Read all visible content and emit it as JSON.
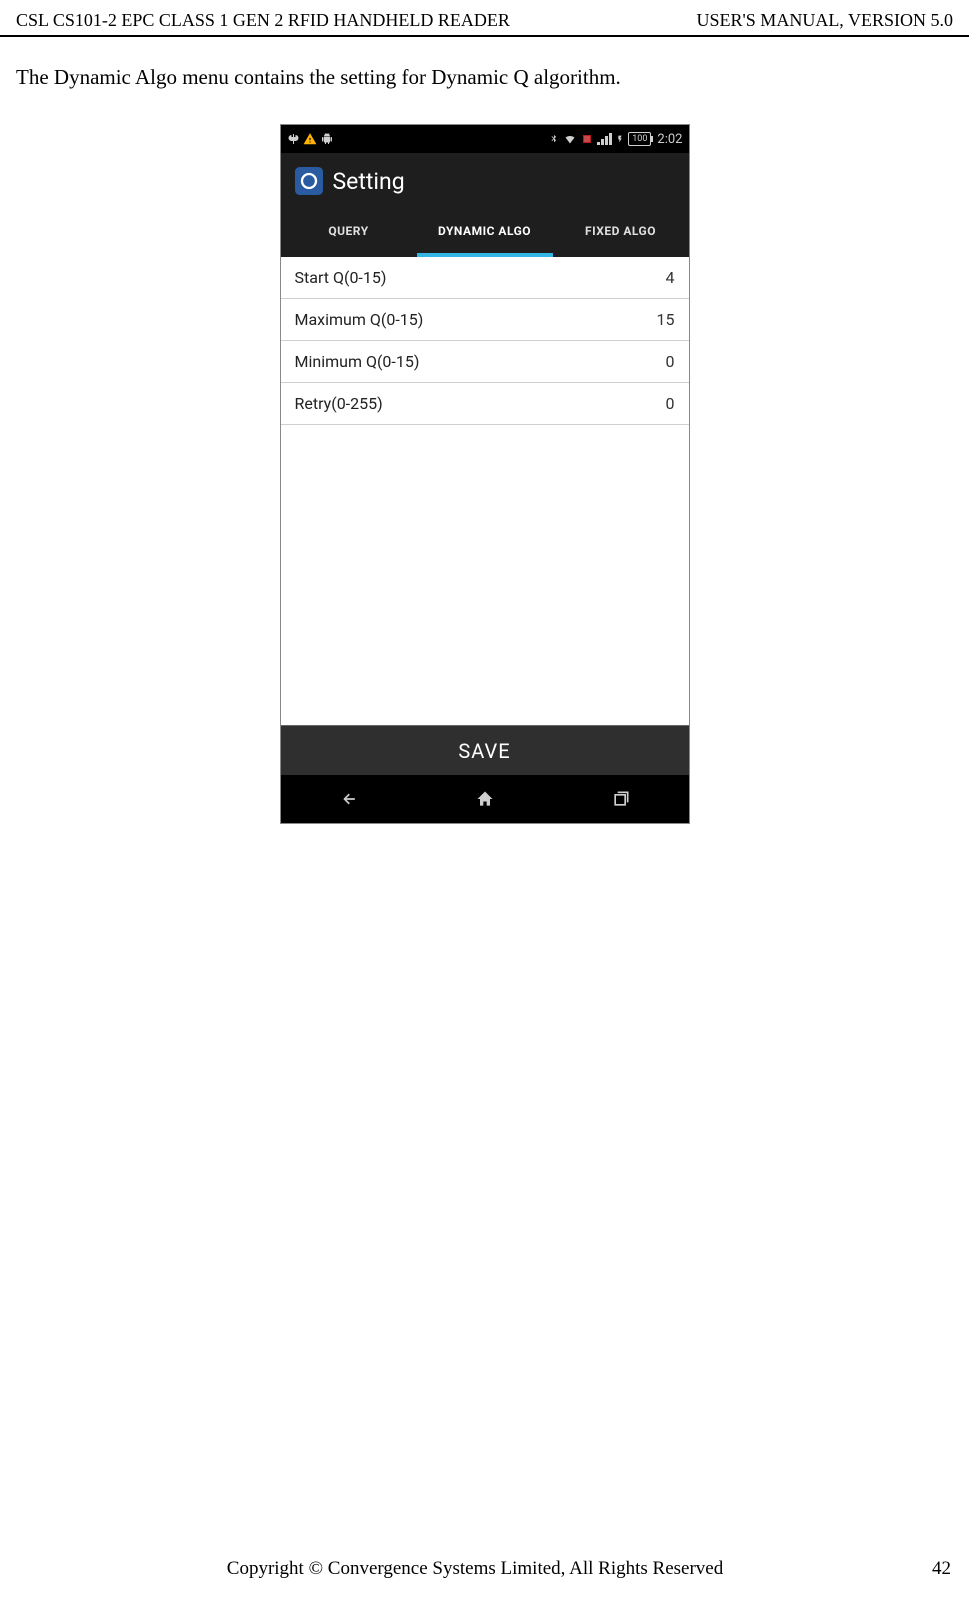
{
  "header": {
    "left": "CSL CS101-2 EPC CLASS 1 GEN 2 RFID HANDHELD READER",
    "right": "USER'S  MANUAL,  VERSION  5.0"
  },
  "body_text": "The Dynamic Algo menu contains the setting for Dynamic Q algorithm.",
  "phone": {
    "status": {
      "battery": "100",
      "time": "2:02"
    },
    "title": "Setting",
    "tabs": [
      {
        "label": "QUERY",
        "active": false
      },
      {
        "label": "DYNAMIC ALGO",
        "active": true
      },
      {
        "label": "FIXED ALGO",
        "active": false
      }
    ],
    "rows": [
      {
        "label": "Start Q(0-15)",
        "value": "4"
      },
      {
        "label": "Maximum Q(0-15)",
        "value": "15"
      },
      {
        "label": "Minimum Q(0-15)",
        "value": "0"
      },
      {
        "label": "Retry(0-255)",
        "value": "0"
      }
    ],
    "save_label": "SAVE"
  },
  "footer": {
    "center": "Copyright © Convergence Systems Limited, All Rights Reserved",
    "page": "42"
  }
}
